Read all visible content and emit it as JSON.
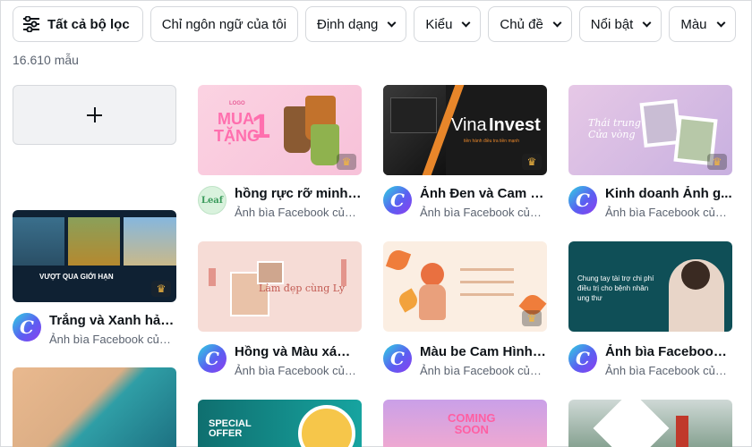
{
  "filters": [
    {
      "label": "Tất cả bộ lọc"
    },
    {
      "label": "Chỉ ngôn ngữ của tôi"
    },
    {
      "label": "Định dạng"
    },
    {
      "label": "Kiểu"
    },
    {
      "label": "Chủ đề"
    },
    {
      "label": "Nổi bật"
    },
    {
      "label": "Màu"
    }
  ],
  "result_count": "16.610 mẫu",
  "templates": [
    {
      "title": "hồng rực rỡ minh ...",
      "subtitle": "Ảnh bìa Facebook của ..."
    },
    {
      "title": "Ảnh Đen và Cam T...",
      "subtitle": "Ảnh bìa Facebook của ..."
    },
    {
      "title": "Kinh doanh Ảnh g...",
      "subtitle": "Ảnh bìa Facebook của ..."
    },
    {
      "title": "Trắng và Xanh hải ...",
      "subtitle": "Ảnh bìa Facebook của ..."
    },
    {
      "title": "Hồng và Màu xám ...",
      "subtitle": "Ảnh bìa Facebook của ..."
    },
    {
      "title": "Màu be Cam Hình ...",
      "subtitle": "Ảnh bìa Facebook của ..."
    },
    {
      "title": "Ảnh bìa Facebook ...",
      "subtitle": "Ảnh bìa Facebook của ..."
    }
  ],
  "thumb_text": {
    "logo_small": "LOGO",
    "mua": "MUA",
    "tang": "TẶNG",
    "one": "1",
    "vina": "Vina",
    "invest": "Invest",
    "vina_tag": "tiền hành điều tra tiền mạnh",
    "thai_trung": "Thái trung\nCửa vòng",
    "vuot": "VƯỢT QUA GIỚI HẠN",
    "lam_dep": "Làm đẹp cùng Ly",
    "chung_tay": "Chung tay tài trợ chi phí điều trị cho bệnh nhân ung thư",
    "special": "SPECIAL\nOFFER",
    "coming": "COMING\nSOON",
    "leaf_logo": "Leaf"
  },
  "colors": {
    "logo_gradient_start": "#2fd2e0",
    "logo_gradient_end": "#8e3ef0",
    "crown": "#f3b640"
  }
}
